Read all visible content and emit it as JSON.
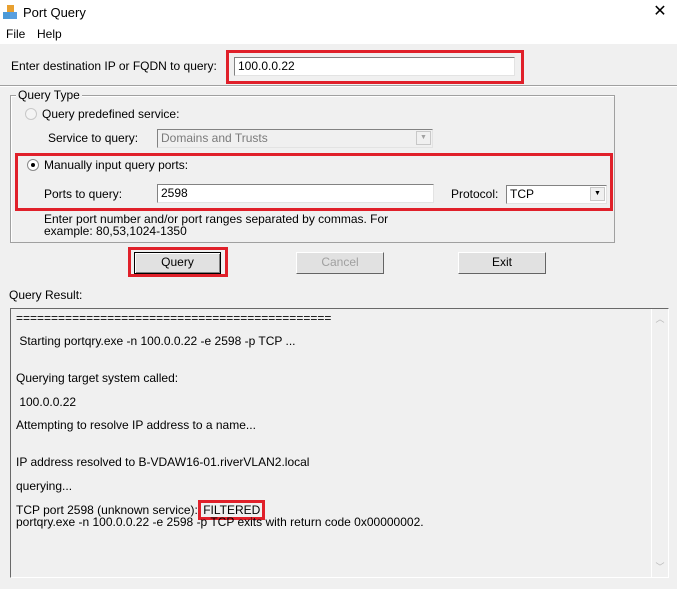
{
  "window": {
    "title": "Port Query",
    "close_icon": "close-icon"
  },
  "menu": {
    "items": [
      {
        "label": "File"
      },
      {
        "label": "Help"
      }
    ]
  },
  "destination": {
    "label": "Enter destination IP or FQDN to query:",
    "value": "100.0.0.22"
  },
  "query_type": {
    "title": "Query Type",
    "predefined": {
      "label": "Query predefined service:",
      "selected": false,
      "service_label": "Service to query:",
      "service_value": "Domains and Trusts"
    },
    "manual": {
      "label": "Manually input query ports:",
      "selected": true,
      "ports_label": "Ports to query:",
      "ports_value": "2598",
      "protocol_label": "Protocol:",
      "protocol_value": "TCP",
      "hint_line1": "Enter port number and/or port ranges separated by commas. For",
      "hint_line2": "example: 80,53,1024-1350"
    }
  },
  "buttons": {
    "query": "Query",
    "cancel": "Cancel",
    "exit": "Exit"
  },
  "result": {
    "label": "Query Result:",
    "lines": [
      "=============================================",
      " Starting portqry.exe -n 100.0.0.22 -e 2598 -p TCP ...",
      "Querying target system called:",
      " 100.0.0.22",
      "Attempting to resolve IP address to a name...",
      "IP address resolved to B-VDAW16-01.riverVLAN2.local",
      "querying...",
      "TCP port 2598 (unknown service): ",
      "portqry.exe -n 100.0.0.22 -e 2598 -p TCP exits with return code 0x00000002."
    ],
    "status": "FILTERED"
  },
  "colors": {
    "highlight": "#e0202a",
    "background": "#f0f0f0"
  }
}
